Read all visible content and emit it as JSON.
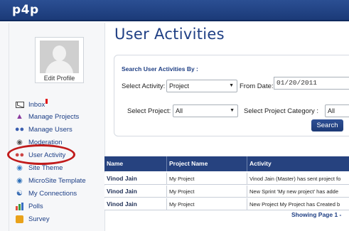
{
  "app": {
    "logo": "p4p"
  },
  "profile": {
    "edit_label": "Edit Profile"
  },
  "sidebar": {
    "items": [
      {
        "label": "Inbox",
        "icon": "inbox-icon"
      },
      {
        "label": "Manage Projects",
        "icon": "projects-icon"
      },
      {
        "label": "Manage Users",
        "icon": "users-icon"
      },
      {
        "label": "Moderation",
        "icon": "moderation-icon"
      },
      {
        "label": "User Activity",
        "icon": "user-activity-icon",
        "highlighted": true
      },
      {
        "label": "Site Theme",
        "icon": "site-theme-icon"
      },
      {
        "label": "MicroSite Template",
        "icon": "microsite-icon"
      },
      {
        "label": "My Connections",
        "icon": "connections-icon"
      },
      {
        "label": "Polls",
        "icon": "polls-icon"
      },
      {
        "label": "Survey",
        "icon": "survey-icon"
      }
    ]
  },
  "page": {
    "title": "User Activities"
  },
  "search": {
    "heading": "Search User Activities By :",
    "activity_label": "Select Activity:",
    "activity_value": "Project",
    "from_date_label": "From Date:",
    "from_date_value": "01/20/2011",
    "project_label": "Select Project:",
    "project_value": "All",
    "category_label": "Select Project Category :",
    "category_value": "All",
    "search_button": "Search"
  },
  "table": {
    "columns": [
      "Name",
      "Project Name",
      "Activity"
    ],
    "rows": [
      [
        "Vinod Jain",
        "My Project",
        "Vinod Jain (Master) has sent project fo"
      ],
      [
        "Vinod Jain",
        "My Project",
        "New Sprint 'My new project' has adde"
      ],
      [
        "Vinod Jain",
        "My Project",
        "New Project My Project has Created b"
      ]
    ]
  },
  "pager": {
    "text": "Showing Page 1 -"
  },
  "colors": {
    "header": "#1b3a78",
    "accent": "#1f3f84",
    "highlight": "#c11b1b",
    "flag": "#e01010"
  }
}
